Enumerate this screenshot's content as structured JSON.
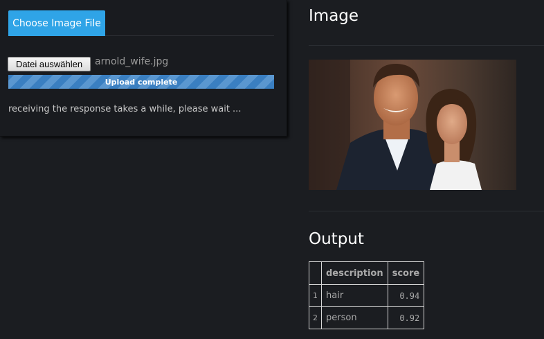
{
  "upload": {
    "tab_label": "Choose Image File",
    "file_button_label": "Datei auswählen",
    "file_name": "arnold_wife.jpg",
    "progress_label": "Upload complete",
    "progress_value": 1.0,
    "status_message": "receiving the response takes a while, please wait ..."
  },
  "image_section": {
    "heading": "Image"
  },
  "output_section": {
    "heading": "Output",
    "columns": [
      "",
      "description",
      "score"
    ],
    "rows": [
      {
        "index": "1",
        "description": "hair",
        "score": "0.94"
      },
      {
        "index": "2",
        "description": "person",
        "score": "0.92"
      }
    ]
  },
  "colors": {
    "background": "#1b1d21",
    "accent": "#2fa4e7",
    "progress": "#3a7fc1"
  }
}
